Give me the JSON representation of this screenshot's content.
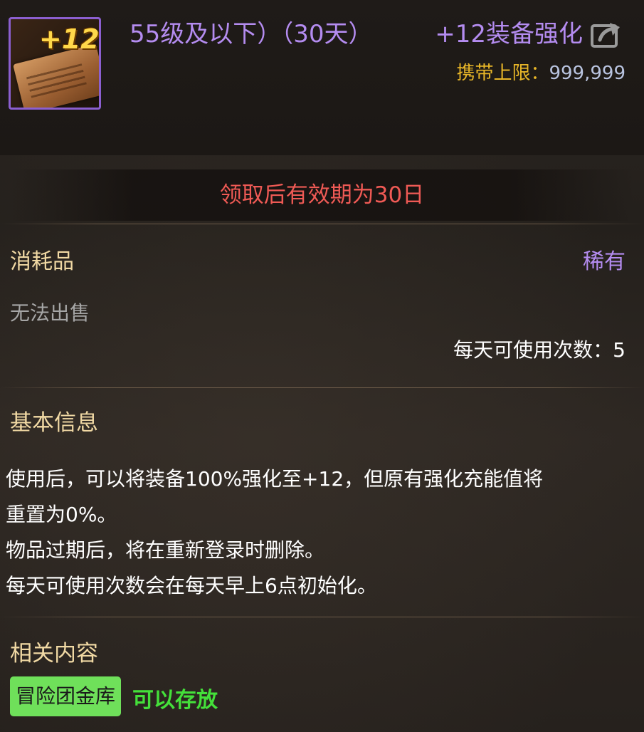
{
  "header": {
    "subtitle": "55级及以下）（30天）",
    "title": "+12装备强化",
    "icon_badge": "+12",
    "carry_label": "携带上限：",
    "carry_value": "999,999"
  },
  "expiry_notice": "领取后有效期为30日",
  "item": {
    "type": "消耗品",
    "rarity": "稀有",
    "sale_status": "无法出售",
    "daily_uses_label": "每天可使用次数：5"
  },
  "basic_info": {
    "title": "基本信息",
    "lines": [
      "使用后，可以将装备100%强化至+12，但原有强化充能值将",
      "重置为0%。",
      "物品过期后，将在重新登录时删除。",
      "每天可使用次数会在每天早上6点初始化。"
    ]
  },
  "related": {
    "title": "相关内容",
    "tag": "冒险团金库",
    "status": "可以存放"
  },
  "colors": {
    "rarity_purple": "#b48cf0",
    "label_gold": "#e8b628",
    "expiry_red": "#ef5a55",
    "tag_green": "#6fe05a",
    "status_green": "#44e03a"
  },
  "icons": [
    "item-scroll-icon",
    "share-icon"
  ]
}
